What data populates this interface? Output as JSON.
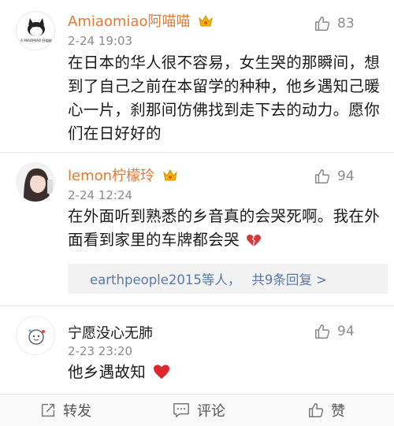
{
  "comments": [
    {
      "avatar_caption": "A MIAOMIAO 阿喵喵",
      "username": "Amiaomiao阿喵喵",
      "time": "2-24 19:03",
      "text": "在日本的华人很不容易，女生哭的那瞬间，想到了自己之前在本留学的种种，他乡遇知己暖心一片，刹那间仿佛找到走下去的动力。愿你们在日好好的",
      "likes": "83"
    },
    {
      "username": "lemon柠檬玲",
      "time": "2-24 12:24",
      "text": "在外面听到熟悉的乡音真的会哭死啊。我在外面看到家里的车牌都会哭",
      "likes": "94",
      "replies_users": "earthpeople2015等人",
      "replies_count": "共9条回复 >"
    },
    {
      "username": "宁愿没心无肺",
      "time": "2-23 23:20",
      "text": "他乡遇故知",
      "likes": "94"
    }
  ],
  "bottom_bar": {
    "forward": "转发",
    "comment": "评论",
    "like": "赞"
  },
  "colors": {
    "username": "#e8792e",
    "reply_link": "#5a7aa8",
    "meta": "#8c8c8c"
  }
}
